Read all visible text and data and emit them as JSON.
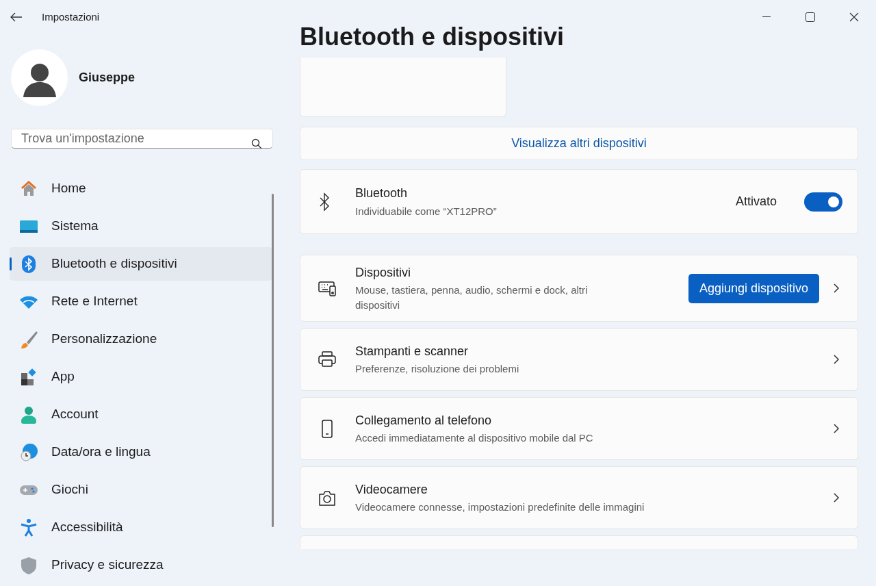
{
  "window": {
    "title": "Impostazioni"
  },
  "user": {
    "name": "Giuseppe"
  },
  "search": {
    "placeholder": "Trova un'impostazione"
  },
  "nav": [
    {
      "label": "Home",
      "kind": "home",
      "selected": false
    },
    {
      "label": "Sistema",
      "kind": "system",
      "selected": false
    },
    {
      "label": "Bluetooth e dispositivi",
      "kind": "bluetooth",
      "selected": true
    },
    {
      "label": "Rete e Internet",
      "kind": "network",
      "selected": false
    },
    {
      "label": "Personalizzazione",
      "kind": "brush",
      "selected": false
    },
    {
      "label": "App",
      "kind": "apps",
      "selected": false
    },
    {
      "label": "Account",
      "kind": "account",
      "selected": false
    },
    {
      "label": "Data/ora e lingua",
      "kind": "time",
      "selected": false
    },
    {
      "label": "Giochi",
      "kind": "gaming",
      "selected": false
    },
    {
      "label": "Accessibilità",
      "kind": "accessibility",
      "selected": false
    },
    {
      "label": "Privacy e sicurezza",
      "kind": "privacy",
      "selected": false
    }
  ],
  "page": {
    "title": "Bluetooth e dispositivi"
  },
  "show_more": {
    "label": "Visualizza altri dispositivi"
  },
  "bluetooth": {
    "title": "Bluetooth",
    "subtitle": "Individuabile come “XT12PRO”",
    "state_label": "Attivato",
    "on": true
  },
  "rows": [
    {
      "kind": "keyboard",
      "title": "Dispositivi",
      "subtitle": "Mouse, tastiera, penna, audio, schermi e dock, altri dispositivi",
      "button": "Aggiungi dispositivo"
    },
    {
      "kind": "printer",
      "title": "Stampanti e scanner",
      "subtitle": "Preferenze, risoluzione dei problemi"
    },
    {
      "kind": "phone",
      "title": "Collegamento al telefono",
      "subtitle": "Accedi immediatamente al dispositivo mobile dal PC"
    },
    {
      "kind": "camera",
      "title": "Videocamere",
      "subtitle": "Videocamere connesse, impostazioni predefinite delle immagini"
    }
  ]
}
